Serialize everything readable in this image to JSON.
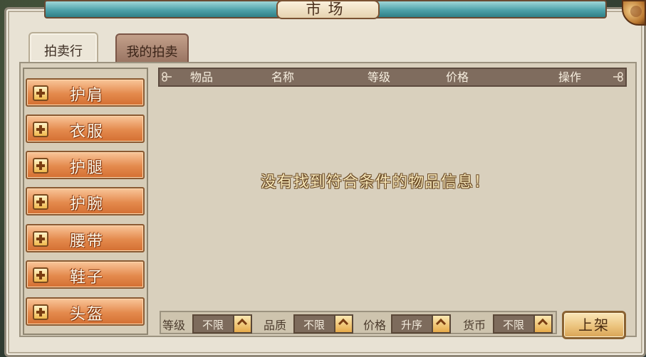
{
  "window": {
    "title": "市场"
  },
  "tabs": [
    {
      "label": "拍卖行"
    },
    {
      "label": "我的拍卖"
    }
  ],
  "categories": [
    {
      "label": "护肩"
    },
    {
      "label": "衣服"
    },
    {
      "label": "护腿"
    },
    {
      "label": "护腕"
    },
    {
      "label": "腰带"
    },
    {
      "label": "鞋子"
    },
    {
      "label": "头盔"
    }
  ],
  "table": {
    "columns": [
      "物品",
      "名称",
      "等级",
      "价格",
      "操作"
    ],
    "empty_message": "没有找到符合条件的物品信息！"
  },
  "filters": [
    {
      "label": "等级",
      "value": "不限"
    },
    {
      "label": "品质",
      "value": "不限"
    },
    {
      "label": "价格",
      "value": "升序"
    },
    {
      "label": "货币",
      "value": "不限"
    }
  ],
  "actions": {
    "list_label": "上架"
  },
  "colors": {
    "category_button": "#e48a4d",
    "table_header": "#7f6c5e",
    "panel_bg": "#d9d0bd",
    "title_bar": "#4ea2aa"
  }
}
